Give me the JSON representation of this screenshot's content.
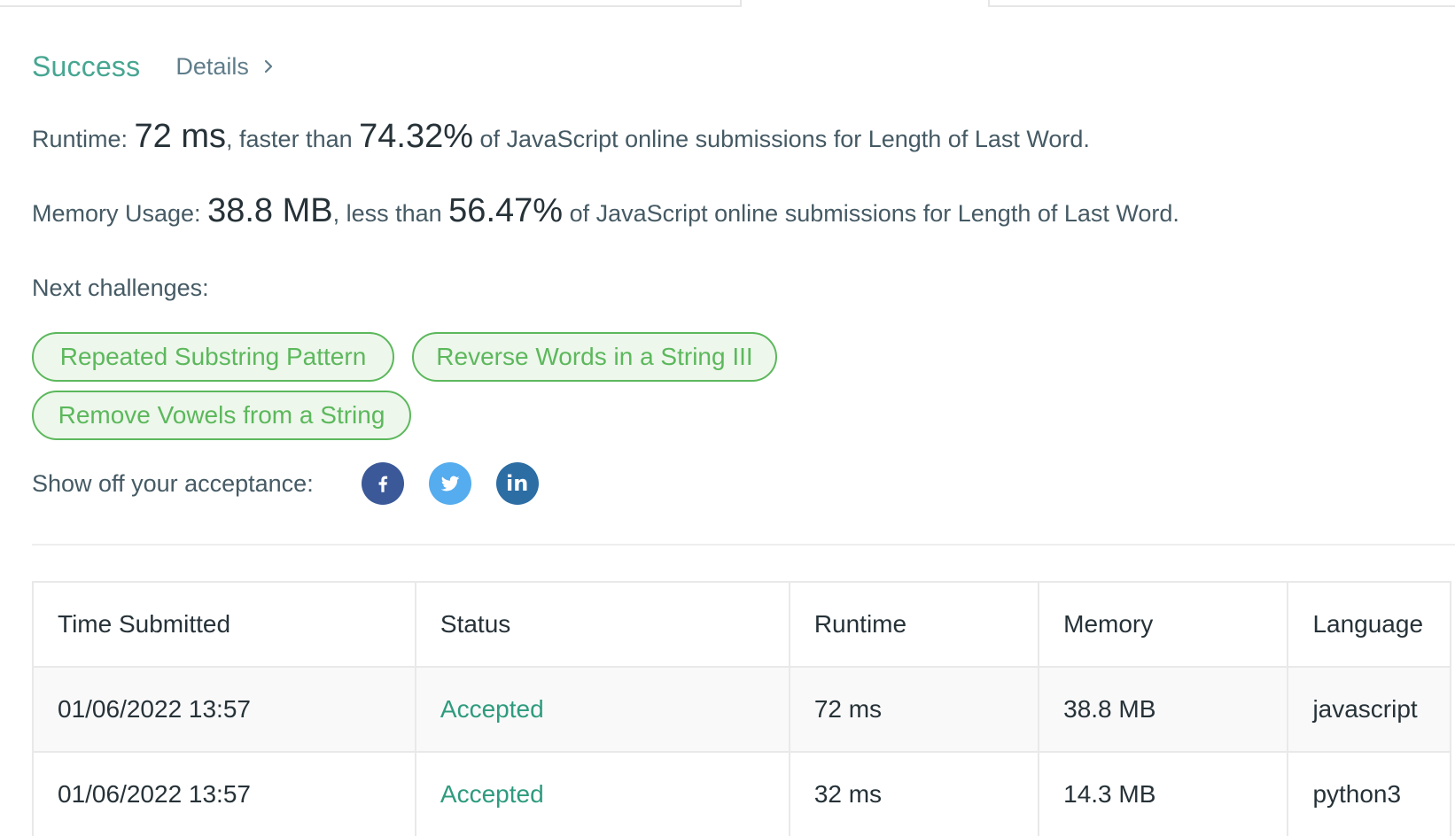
{
  "result": {
    "status": "Success",
    "details_label": "Details"
  },
  "runtime": {
    "label": "Runtime: ",
    "value": "72 ms",
    "connector": ", faster than ",
    "percent": "74.32%",
    "suffix": " of JavaScript online submissions for Length of Last Word."
  },
  "memory": {
    "label": "Memory Usage: ",
    "value": "38.8 MB",
    "connector": ", less than ",
    "percent": "56.47%",
    "suffix": " of JavaScript online submissions for Length of Last Word."
  },
  "next_challenges": {
    "label": "Next challenges:",
    "items": [
      "Repeated Substring Pattern",
      "Reverse Words in a String III",
      "Remove Vowels from a String"
    ]
  },
  "share": {
    "label": "Show off your acceptance:",
    "icons": [
      "facebook-icon",
      "twitter-icon",
      "linkedin-icon"
    ],
    "linkedin_text": "in"
  },
  "colors": {
    "success": "#47a692",
    "chip": "#5cb85c",
    "accepted": "#2e9b7e",
    "facebook": "#3b5998",
    "twitter": "#55acee",
    "linkedin": "#2c6da4"
  },
  "submissions": {
    "headers": [
      "Time Submitted",
      "Status",
      "Runtime",
      "Memory",
      "Language"
    ],
    "rows": [
      [
        "01/06/2022 13:57",
        "Accepted",
        "72 ms",
        "38.8 MB",
        "javascript"
      ],
      [
        "01/06/2022 13:57",
        "Accepted",
        "32 ms",
        "14.3 MB",
        "python3"
      ]
    ]
  }
}
